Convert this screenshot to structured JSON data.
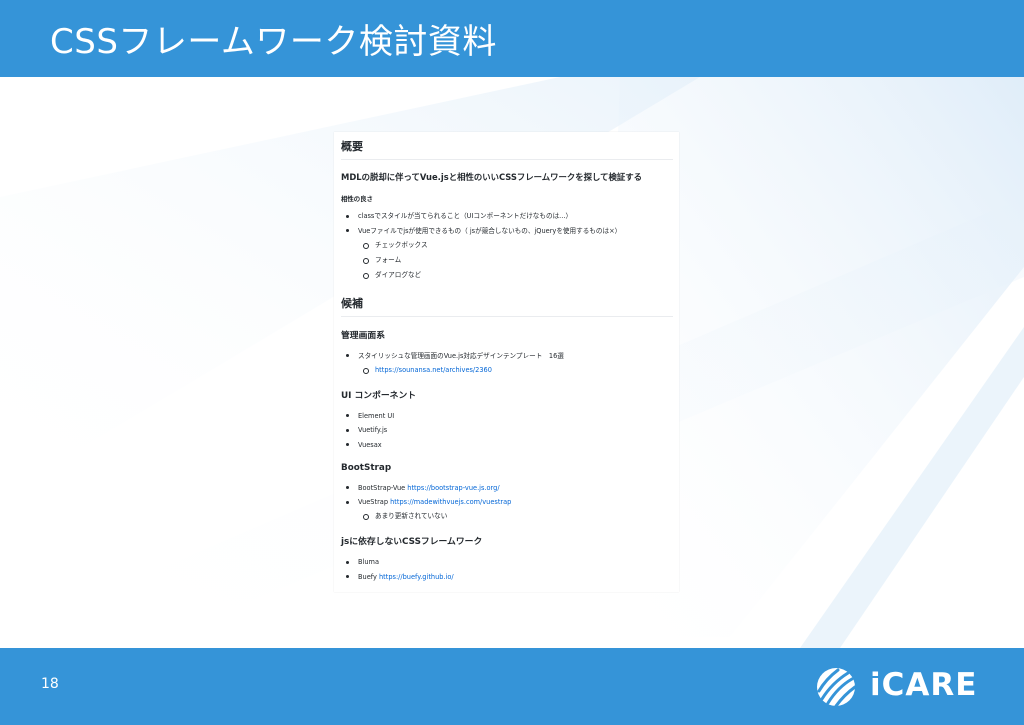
{
  "slide": {
    "title": "CSSフレームワーク検討資料",
    "page_number": "18",
    "brand": "iCARE"
  },
  "colors": {
    "header": "#3594d8",
    "footer": "#3594d8",
    "link": "#0366d6"
  },
  "doc": {
    "overview_heading": "概要",
    "goal": "MDLの脱却に伴ってVue.jsと相性のいいCSSフレームワークを探して検証する",
    "compat_heading": "相性の良さ",
    "compat_item1": "classでスタイルが当てられること（UIコンポーネントだけなものは...）",
    "compat_item2": "Vueファイルでjsが使用できるもの（ jsが競合しないもの、jQueryを使用するものは×）",
    "compat_sub": [
      "チェックボックス",
      "フォーム",
      "ダイアログなど"
    ],
    "candidates_heading": "候補",
    "admin_heading": "管理画面系",
    "admin_item": "スタイリッシュな管理画面のVue.js対応デザインテンプレート　16選",
    "admin_link": "https://sounansa.net/archives/2360",
    "ui_heading": "UI コンポーネント",
    "ui_items": [
      "Element UI",
      "Vuetify.js",
      "Vuesax"
    ],
    "bootstrap_heading": "BootStrap",
    "bs1_name": "BootStrap-Vue",
    "bs1_link": "https://bootstrap-vue.js.org/",
    "bs2_name": "VueStrap",
    "bs2_link": "https://madewithvuejs.com/vuestrap",
    "bs2_note": "あまり更新されていない",
    "nojs_heading": "jsに依存しないCSSフレームワーク",
    "nojs1_name": "Bluma",
    "nojs2_name": "Buefy",
    "nojs2_link": "https://buefy.github.io/"
  }
}
